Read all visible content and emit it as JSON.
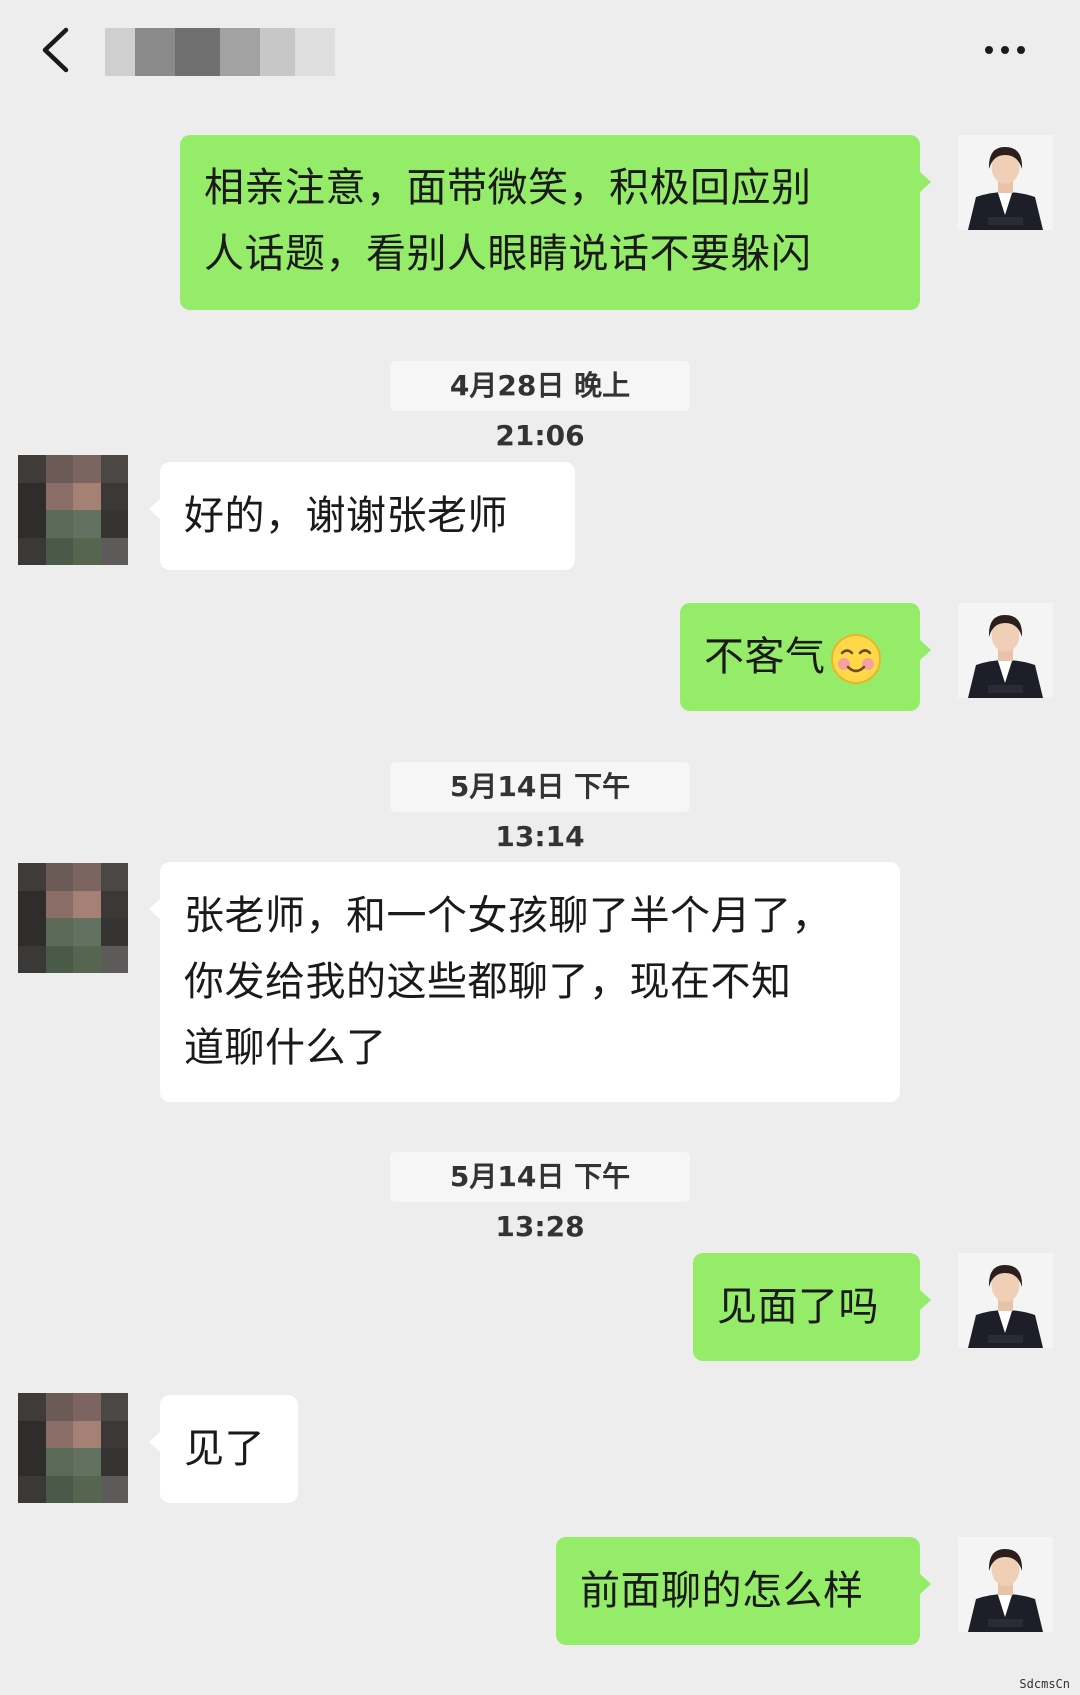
{
  "header": {
    "back_icon": "chevron-left-icon",
    "contact_name": "",
    "more_icon": "more-dots-icon"
  },
  "messages": [
    {
      "from": "me",
      "lines": [
        "相亲注意，面带微笑，积极回应别",
        "人话题，看别人眼睛说话不要躲闪"
      ]
    },
    {
      "type": "time",
      "text": "4月28日 晚上21:06"
    },
    {
      "from": "them",
      "lines": [
        "好的，谢谢张老师"
      ]
    },
    {
      "from": "me",
      "lines": [
        "不客气"
      ],
      "emoji": "smiling-blush-emoji"
    },
    {
      "type": "time",
      "text": "5月14日 下午13:14"
    },
    {
      "from": "them",
      "lines": [
        "张老师，和一个女孩聊了半个月了，",
        "你发给我的这些都聊了，现在不知",
        "道聊什么了"
      ]
    },
    {
      "type": "time",
      "text": "5月14日 下午13:28"
    },
    {
      "from": "me",
      "lines": [
        "见面了吗"
      ]
    },
    {
      "from": "them",
      "lines": [
        "见了"
      ]
    },
    {
      "from": "me",
      "lines": [
        "前面聊的怎么样"
      ]
    }
  ],
  "watermark": "SdcmsCn",
  "colors": {
    "background": "#ededed",
    "my_bubble": "#95ec69",
    "their_bubble": "#ffffff",
    "time_chip": "#f6f6f6"
  }
}
